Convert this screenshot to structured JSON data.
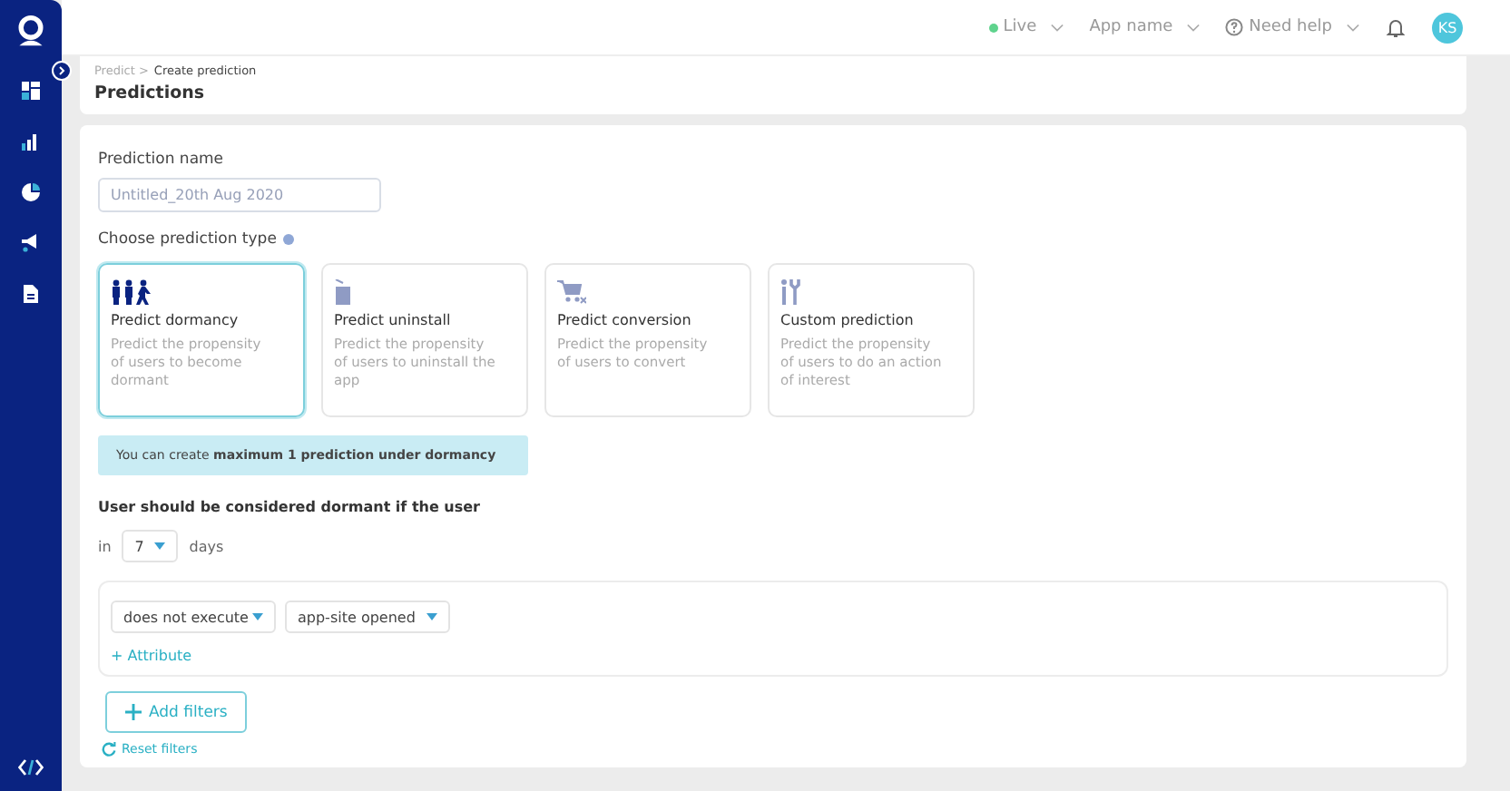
{
  "topbar": {
    "live": {
      "label": "Live",
      "color": "#5fd38d"
    },
    "app_menu": "App name",
    "help_menu": "Need help",
    "avatar": "KS"
  },
  "header": {
    "breadcrumb": [
      {
        "label": "Predict >",
        "current": false
      },
      {
        "label": "Create prediction",
        "current": true
      }
    ],
    "title": "Predictions"
  },
  "form": {
    "name_label": "Prediction name",
    "name_placeholder": "Untitled_20th Aug 2020",
    "type_label": "Choose prediction type",
    "prediction_types": [
      {
        "kind": "dormancy",
        "title": "Predict dormancy",
        "description": "Predict the propensity of users to become dormant",
        "selected": true
      },
      {
        "kind": "uninstall",
        "title": "Predict uninstall",
        "description": "Predict the propensity of users to uninstall the app",
        "selected": false
      },
      {
        "kind": "conversion",
        "title": "Predict conversion",
        "description": "Predict the propensity of users to convert",
        "selected": false
      },
      {
        "kind": "custom",
        "title": "Custom prediction",
        "description": "Predict the propensity of users to do an action of interest",
        "selected": false
      }
    ],
    "notice": "You can create **maximum 1 prediction under dormancy**",
    "condition_heading": "User should be considered dormant if the user",
    "period": {
      "prefix": "in",
      "value": "7",
      "suffix": "days"
    },
    "filter": {
      "action": "does not execute",
      "event": "app-site opened",
      "add_attribute": "+ Attribute"
    },
    "add_filters": "Add filters",
    "reset_filters": "Reset filters"
  }
}
